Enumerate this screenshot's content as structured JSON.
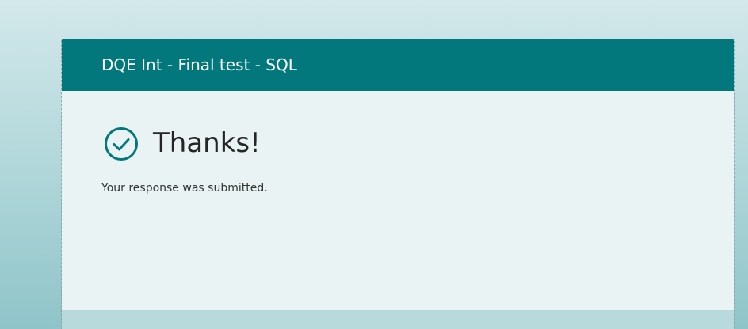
{
  "form": {
    "title": "DQE Int - Final test - SQL"
  },
  "confirmation": {
    "icon": "check-circle-icon",
    "heading": "Thanks!",
    "message": "Your response was submitted."
  },
  "colors": {
    "header_background": "#03787c",
    "body_background": "#e9f3f4",
    "icon_color": "#03787c",
    "page_background_top": "#d3e8ea",
    "page_background_bottom": "#8fc4c8"
  }
}
